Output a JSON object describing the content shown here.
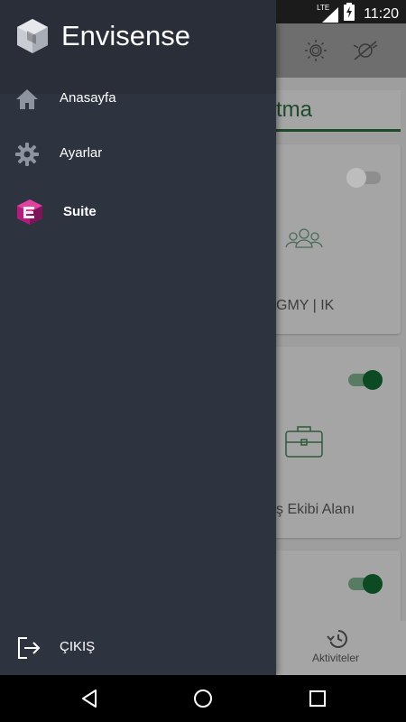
{
  "status_bar": {
    "time": "11:20",
    "network": "LTE",
    "icons": [
      "android-icon",
      "signal-icon",
      "battery-charging-icon"
    ]
  },
  "drawer": {
    "brand": "Envisense",
    "items": [
      {
        "label": "Anasayfa",
        "icon": "home-icon"
      },
      {
        "label": "Ayarlar",
        "icon": "gear-icon"
      },
      {
        "label": "Suite",
        "icon": "suite-logo-icon"
      }
    ],
    "logout": {
      "label": "ÇIKIŞ",
      "icon": "logout-icon"
    }
  },
  "background_app": {
    "tab_title": "tma",
    "cards": [
      {
        "label": "GMY | IK",
        "toggle": false,
        "icon": "people-group-icon"
      },
      {
        "label": "ş Ekibi Alanı",
        "toggle": true,
        "icon": "briefcase-icon"
      },
      {
        "label": "",
        "toggle": true
      }
    ],
    "bottom_nav": {
      "label": "Aktiviteler",
      "icon": "history-icon"
    }
  },
  "colors": {
    "drawer_bg": "#2e3340",
    "drawer_header": "#2a2e39",
    "accent_green": "#0b4a23",
    "icon_gray": "#9aa0ab"
  }
}
